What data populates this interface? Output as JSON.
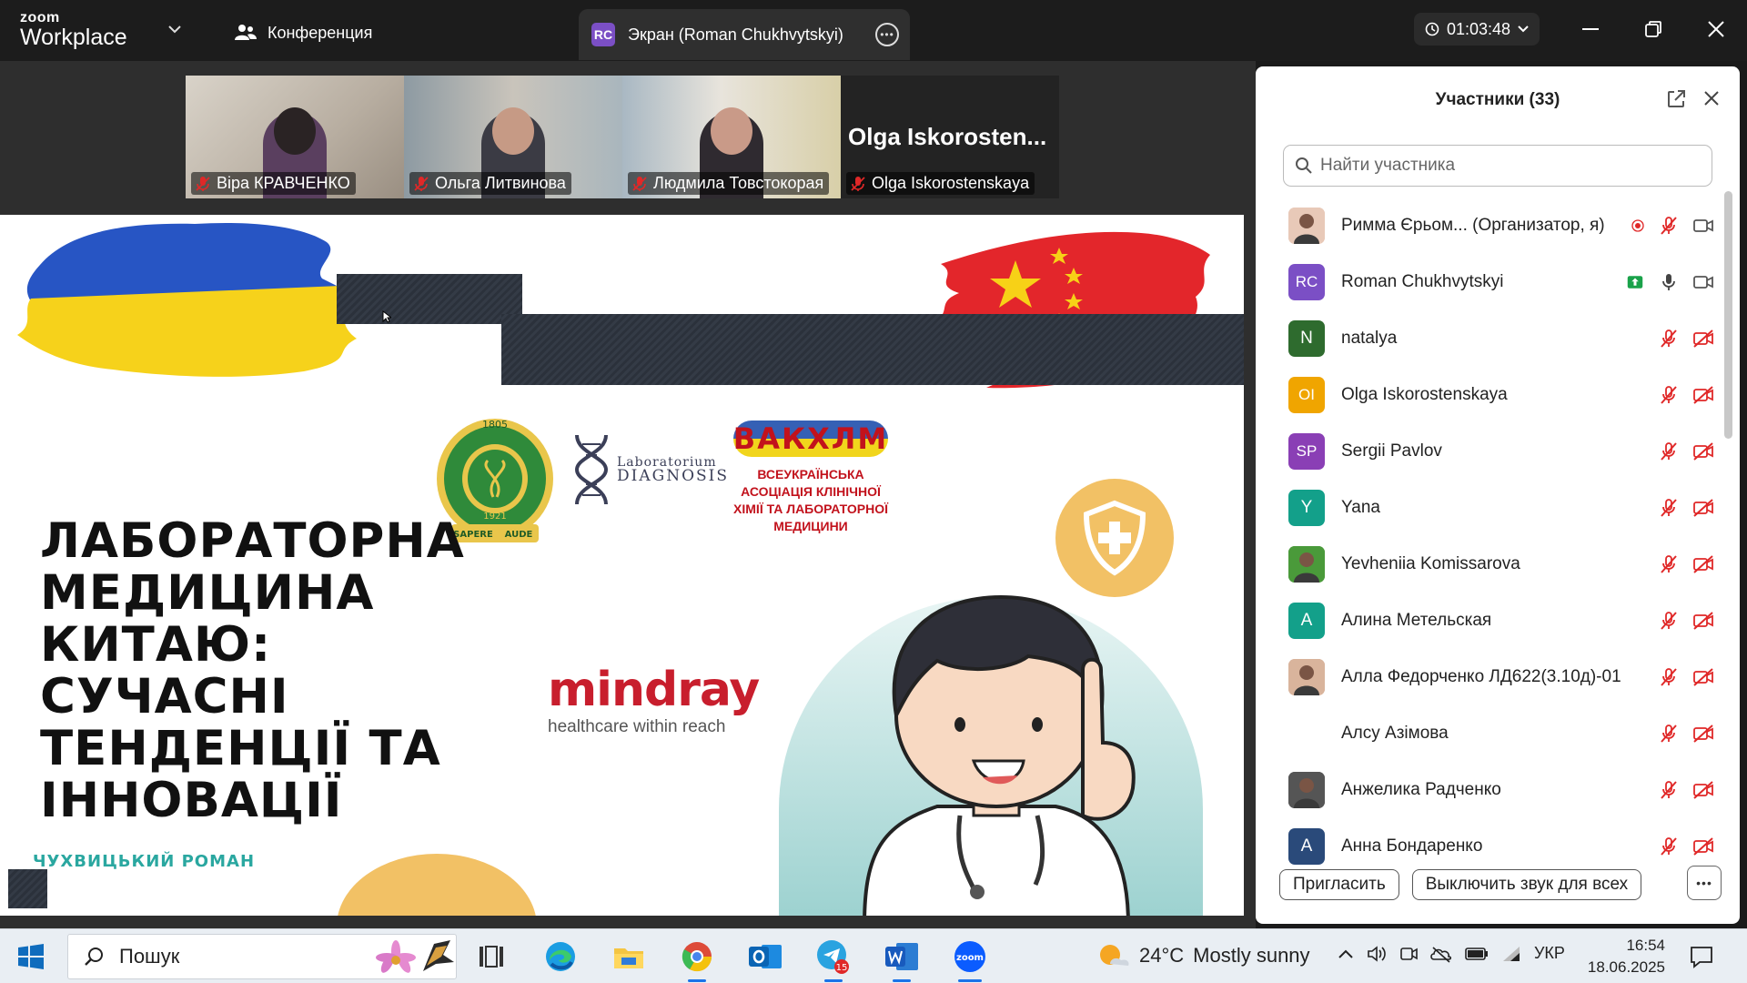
{
  "topbar": {
    "brand_top": "zoom",
    "brand_main": "Workplace",
    "conference_label": "Конференция",
    "screen_tab": {
      "badge": "RC",
      "label": "Экран (Roman Chukhvytskyi)"
    },
    "timer": "01:03:48"
  },
  "videos": [
    {
      "name": "Віра КРАВЧЕНКО",
      "muted": true
    },
    {
      "name": "Ольга Литвинова",
      "muted": true
    },
    {
      "name": "Людмила Товстокорая",
      "muted": true
    },
    {
      "name": "Olga Iskorostenskaya",
      "muted": true,
      "big_label": "Olga  Iskorosten..."
    }
  ],
  "slide": {
    "title": "ЛАБОРАТОРНА МЕДИЦИНА КИТАЮ: СУЧАСНІ ТЕНДЕНЦІЇ ТА ІННОВАЦІЇ",
    "author": "ЧУХВИЦЬКИЙ РОМАН",
    "mindray": "mindray",
    "mindray_tag": "healthcare within reach",
    "lab_logo_line1": "Laboratorium",
    "lab_logo_line2": "DIAGNOSIS",
    "vak_word": "ВАКХЛМ",
    "vak_sub": "ВСЕУКРАЇНСЬКА АСОЦІАЦІЯ КЛІНІЧНОЇ ХІМІЇ ТА ЛАБОРАТОРНОЇ МЕДИЦИНИ",
    "uni_year_top": "1805",
    "uni_year_mid": "1921",
    "uni_motto_left": "SAPERE",
    "uni_motto_right": "AUDE"
  },
  "panel": {
    "title": "Участники (33)",
    "search_placeholder": "Найти участника",
    "participants": [
      {
        "name": "Римма Єрьом... (Организатор, я)",
        "avatar": "photo",
        "color": "#e8c9b8",
        "mic": "muted",
        "video": "on",
        "recording": true
      },
      {
        "name": "Roman Chukhvytskyi",
        "avatar": "RC",
        "color": "#7b4fc5",
        "mic": "on",
        "video": "on",
        "sharing": true
      },
      {
        "name": "natalya",
        "avatar": "N",
        "color": "#2e6b2e",
        "mic": "muted",
        "video": "off"
      },
      {
        "name": "Olga Iskorostenskaya",
        "avatar": "OI",
        "color": "#f0a500",
        "mic": "muted",
        "video": "off"
      },
      {
        "name": "Sergii Pavlov",
        "avatar": "SP",
        "color": "#8a3fb5",
        "mic": "muted",
        "video": "off"
      },
      {
        "name": "Yana",
        "avatar": "Y",
        "color": "#13a08a",
        "mic": "muted",
        "video": "off"
      },
      {
        "name": "Yevheniia Komissarova",
        "avatar": "photo",
        "color": "#4a9a3a",
        "mic": "muted",
        "video": "off"
      },
      {
        "name": "Алина Метельская",
        "avatar": "A",
        "color": "#13a08a",
        "mic": "muted",
        "video": "off"
      },
      {
        "name": "Алла Федорченко ЛД622(3.10д)-01",
        "avatar": "photo",
        "color": "#d9b49c",
        "mic": "muted",
        "video": "off"
      },
      {
        "name": "Алсу Азімова",
        "avatar": "",
        "color": "#ffffff",
        "mic": "muted",
        "video": "off"
      },
      {
        "name": "Анжелика Радченко",
        "avatar": "photo",
        "color": "#555555",
        "mic": "muted",
        "video": "off"
      },
      {
        "name": "Анна Бондаренко",
        "avatar": "A",
        "color": "#2a4a7a",
        "mic": "muted",
        "video": "off"
      }
    ],
    "invite_label": "Пригласить",
    "mute_all_label": "Выключить звук для всех"
  },
  "taskbar": {
    "search_label": "Пошук",
    "telegram_badge": "15",
    "weather_temp": "24°C",
    "weather_desc": "Mostly sunny",
    "lang": "УКР",
    "time": "16:54",
    "date": "18.06.2025"
  },
  "colors": {
    "accent_blue": "#0e71eb",
    "mute_red": "#e02828",
    "zoom_dark": "#1c1c1c"
  }
}
